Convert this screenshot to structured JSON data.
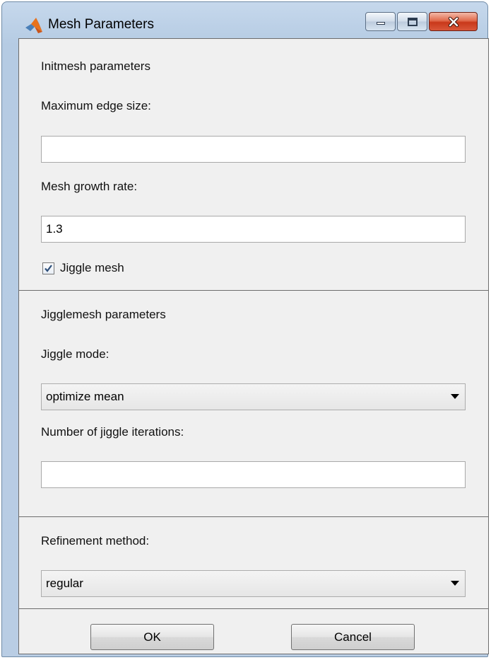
{
  "window": {
    "title": "Mesh Parameters",
    "app_icon": "matlab-logo-icon",
    "controls": [
      "minimize-icon",
      "maximize-icon",
      "close-icon"
    ]
  },
  "initmesh": {
    "heading": "Initmesh parameters",
    "max_edge_label": "Maximum edge size:",
    "max_edge_value": "",
    "growth_label": "Mesh growth rate:",
    "growth_value": "1.3",
    "jiggle_checkbox_label": "Jiggle mesh",
    "jiggle_checked": true
  },
  "jigglemesh": {
    "heading": "Jigglemesh parameters",
    "mode_label": "Jiggle mode:",
    "mode_value": "optimize mean",
    "iterations_label": "Number of jiggle iterations:",
    "iterations_value": ""
  },
  "refinement": {
    "label": "Refinement method:",
    "value": "regular"
  },
  "buttons": {
    "ok": "OK",
    "cancel": "Cancel"
  }
}
